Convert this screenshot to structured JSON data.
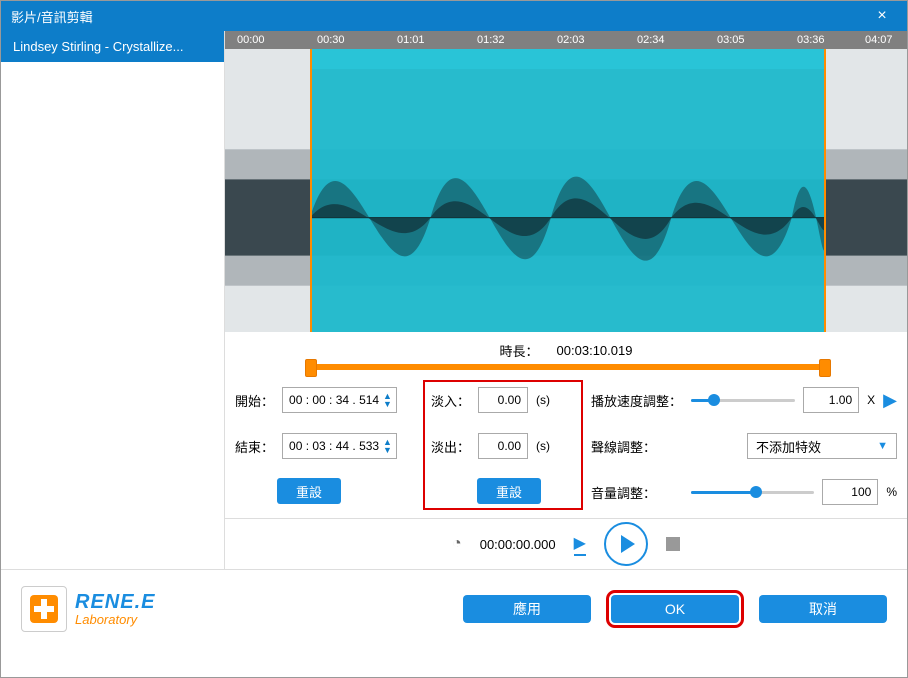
{
  "title": "影片/音訊剪輯",
  "sidebar": {
    "item": "Lindsey Stirling - Crystallize..."
  },
  "timeline": [
    "00:00",
    "00:30",
    "01:01",
    "01:32",
    "02:03",
    "02:34",
    "03:05",
    "03:36",
    "04:07"
  ],
  "duration": {
    "label": "時長：",
    "value": "00:03:10.019"
  },
  "start": {
    "label": "開始：",
    "value": "00 : 00 : 34 . 514"
  },
  "end": {
    "label": "結束：",
    "value": "00 : 03 : 44 . 533"
  },
  "fade_in": {
    "label": "淡入：",
    "value": "0.00",
    "unit": "(s)"
  },
  "fade_out": {
    "label": "淡出：",
    "value": "0.00",
    "unit": "(s)"
  },
  "reset": "重設",
  "speed": {
    "label": "播放速度調整：",
    "value": "1.00",
    "unit": "X"
  },
  "sound": {
    "label": "聲線調整：",
    "selected": "不添加特效"
  },
  "volume": {
    "label": "音量調整：",
    "value": "100",
    "unit": "%"
  },
  "playback_time": "00:00:00.000",
  "logo": {
    "brand": "RENE.E",
    "sub": "Laboratory"
  },
  "footer": {
    "apply": "應用",
    "ok": "OK",
    "cancel": "取消"
  }
}
